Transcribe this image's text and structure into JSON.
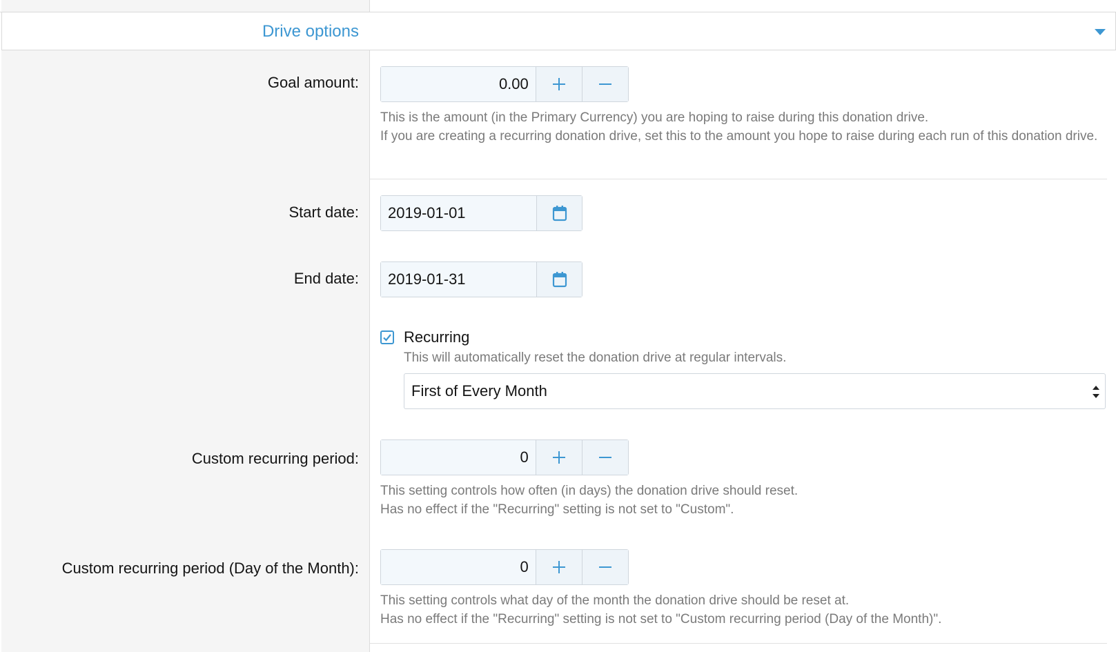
{
  "section": {
    "title": "Drive options"
  },
  "colors": {
    "accent": "#3d97d2",
    "help_text": "#7a7a7a",
    "label_bg": "#f5f5f5"
  },
  "goal_amount": {
    "label": "Goal amount:",
    "value": "0.00",
    "help_line1": "This is the amount (in the Primary Currency) you are hoping to raise during this donation drive.",
    "help_line2": "If you are creating a recurring donation drive, set this to the amount you hope to raise during each run of this donation drive."
  },
  "start_date": {
    "label": "Start date:",
    "value": "2019-01-01"
  },
  "end_date": {
    "label": "End date:",
    "value": "2019-01-31"
  },
  "recurring": {
    "label": "Recurring",
    "checked": true,
    "help": "This will automatically reset the donation drive at regular intervals.",
    "selected_option": "First of Every Month"
  },
  "custom_period": {
    "label": "Custom recurring period:",
    "value": "0",
    "help_line1": "This setting controls how often (in days) the donation drive should reset.",
    "help_line2": "Has no effect if the \"Recurring\" setting is not set to \"Custom\"."
  },
  "custom_period_day": {
    "label": "Custom recurring period (Day of the Month):",
    "value": "0",
    "help_line1": "This setting controls what day of the month the donation drive should be reset at.",
    "help_line2": "Has no effect if the \"Recurring\" setting is not set to \"Custom recurring period (Day of the Month)\"."
  },
  "icons": {
    "increment": "plus-icon",
    "decrement": "minus-icon",
    "calendar": "calendar-icon",
    "collapse": "caret-down-icon",
    "select": "updown-icon"
  }
}
